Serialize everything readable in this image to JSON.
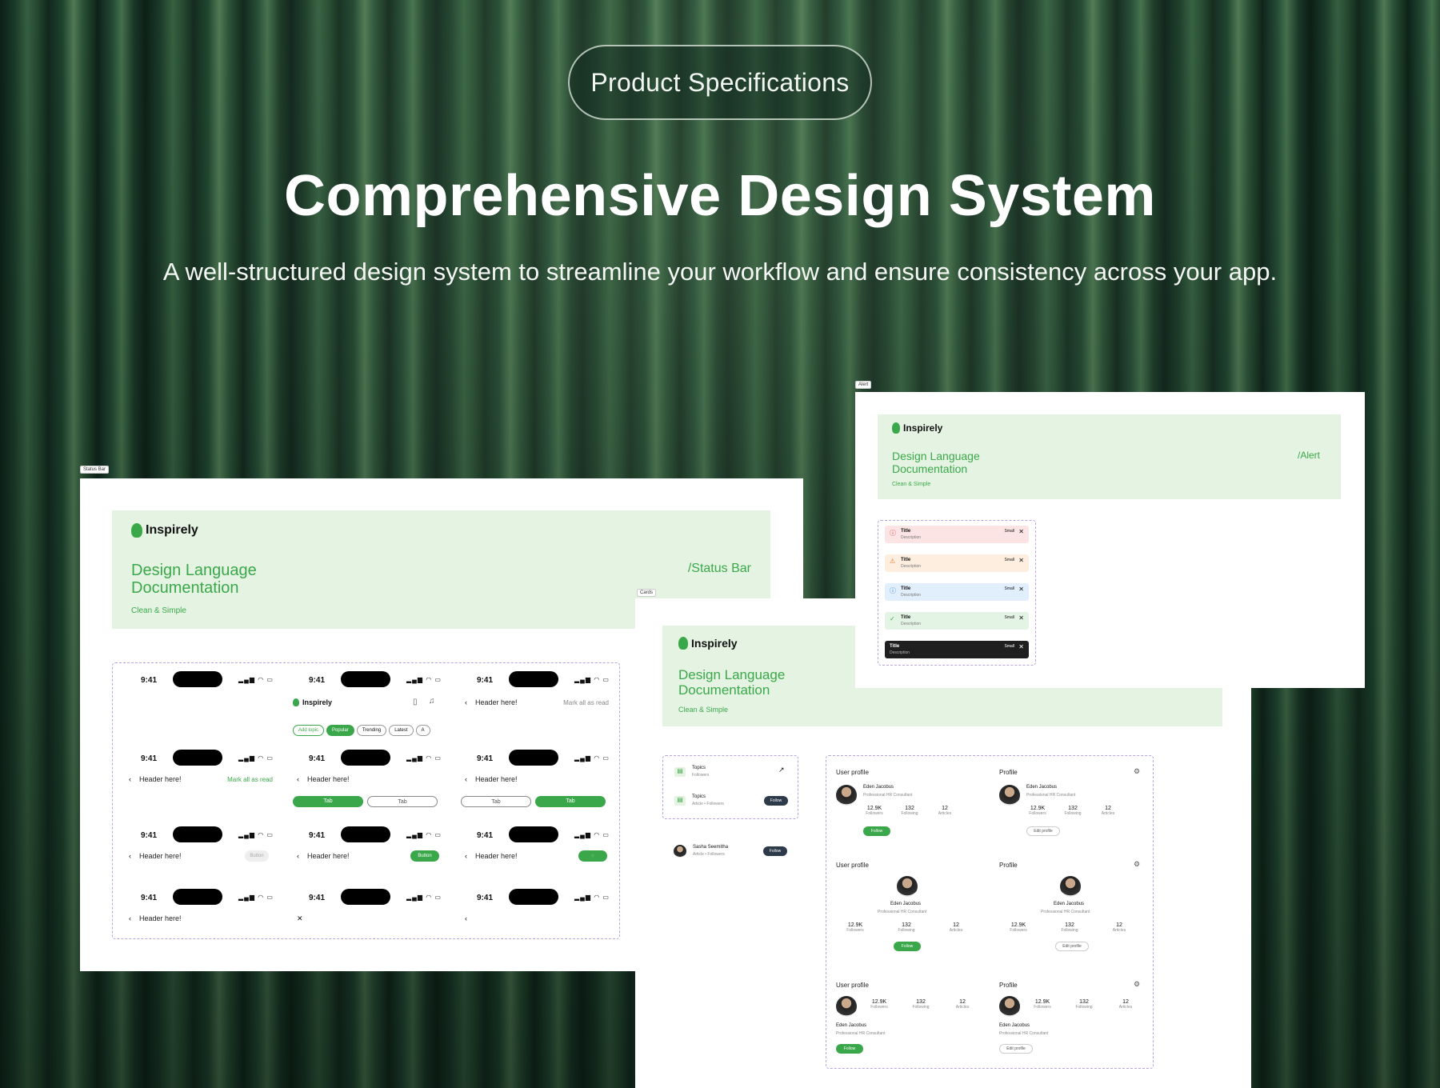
{
  "header": {
    "pill": "Product Specifications",
    "title": "Comprehensive Design System",
    "subtitle": "A well-structured design system to streamline your workflow and ensure consistency across your app."
  },
  "doc": {
    "brand": "Inspirely",
    "title_line1": "Design Language",
    "title_line2": "Documentation",
    "tagline": "Clean & Simple"
  },
  "status_panel": {
    "frame_tag": "Status Bar",
    "section": "/Status Bar",
    "time": "9:41",
    "header_text": "Header here!",
    "mark_all": "Mark all as read",
    "tab": "Tab",
    "button": "Button",
    "chips": [
      "Add topic",
      "Popular",
      "Trending",
      "Latest",
      "A"
    ]
  },
  "alert_panel": {
    "frame_tag": "Alert",
    "section": "/Alert",
    "title": "Title",
    "description": "Description",
    "small": "Small",
    "colors": [
      "#fde4e4",
      "#fdeee0",
      "#e1eefc",
      "#e4f4e4",
      "#1f1f1f"
    ]
  },
  "cards_panel": {
    "frame_tag": "Cards",
    "topics": "Topics",
    "followers": "Followers",
    "article_followers": "Article • Followers",
    "follow": "Follow",
    "person": "Sasha Seemitha",
    "user_profile": "User profile",
    "profile": "Profile",
    "name": "Eden Jacobus",
    "role": "Professional HR Consultant",
    "stats": [
      {
        "value": "12.9K",
        "label": "Followers"
      },
      {
        "value": "132",
        "label": "Following"
      },
      {
        "value": "12",
        "label": "Articles"
      }
    ],
    "edit_profile": "Edit profile"
  }
}
